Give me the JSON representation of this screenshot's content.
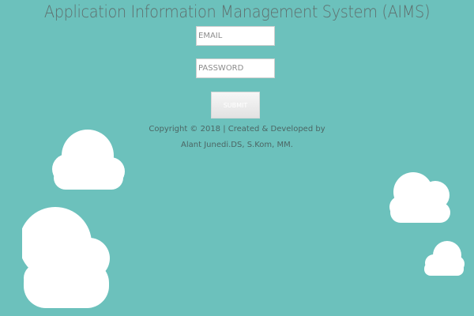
{
  "header": {
    "title": "Application Information Management System (AIMS)"
  },
  "login_form": {
    "email_placeholder": "EMAIL",
    "password_placeholder": "PASSWORD",
    "submit_label": "SUBMIT"
  },
  "footer": {
    "copyright_line1": "Copyright © 2018 | Created & Developed by",
    "copyright_line2": "Alant Junedi.DS, S.Kom, MM."
  },
  "colors": {
    "background": "#6cc1bc",
    "cloud": "#ffffff",
    "title_text": "#5f6f6e",
    "footer_text": "#4c6664"
  }
}
